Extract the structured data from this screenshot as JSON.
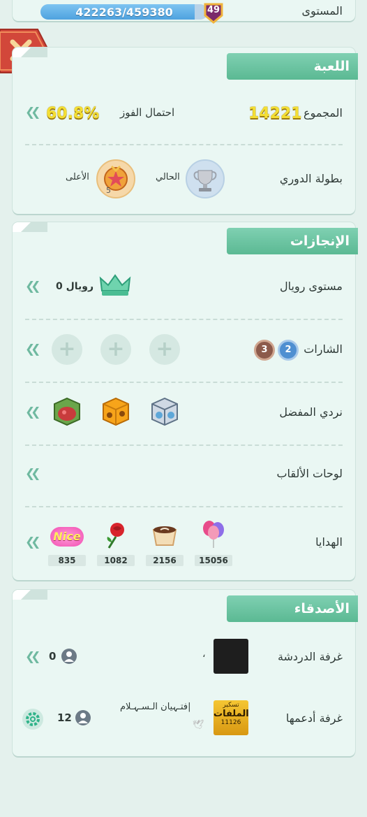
{
  "header": {
    "level_label": "المستوى",
    "xp": "422263/459380",
    "level": "49",
    "xp_progress": 0.919
  },
  "game": {
    "title": "اللعبة",
    "total_label": "المجموع",
    "total_value": "14221",
    "win_label": "احتمال الفوز",
    "win_value": "60.8%",
    "league_label": "بطولة الدوري",
    "current_label": "الحالي",
    "highest_label": "الأعلى",
    "highest_rank": "5"
  },
  "achievements": {
    "title": "الإنجازات",
    "royal_label": "مستوى رويال",
    "royal_value": "رويال 0",
    "badges_label": "الشارات",
    "badge_a": "2",
    "badge_b": "3",
    "dice_label": "نردي المفضل",
    "titles_label": "لوحات الألقاب",
    "gifts_label": "الهدايا",
    "gifts": [
      {
        "icon": "balloons-icon",
        "count": "15056"
      },
      {
        "icon": "coffee-cup-icon",
        "count": "2156"
      },
      {
        "icon": "rose-icon",
        "count": "1082"
      },
      {
        "icon": "nice-sticker-icon",
        "count": "835"
      }
    ],
    "nice_text": "Nice"
  },
  "friends": {
    "title": "الأصدقاء",
    "chat_label": "غرفة الدردشة",
    "chat_name": "،",
    "chat_count": "0",
    "support_label": "غرفة أدعمها",
    "support_name": "فتـہيان الـسـہـلام|",
    "support_count": "12",
    "support_badge_top": "تسكير",
    "support_badge_main": "الملفات",
    "support_badge_num": "11126"
  }
}
